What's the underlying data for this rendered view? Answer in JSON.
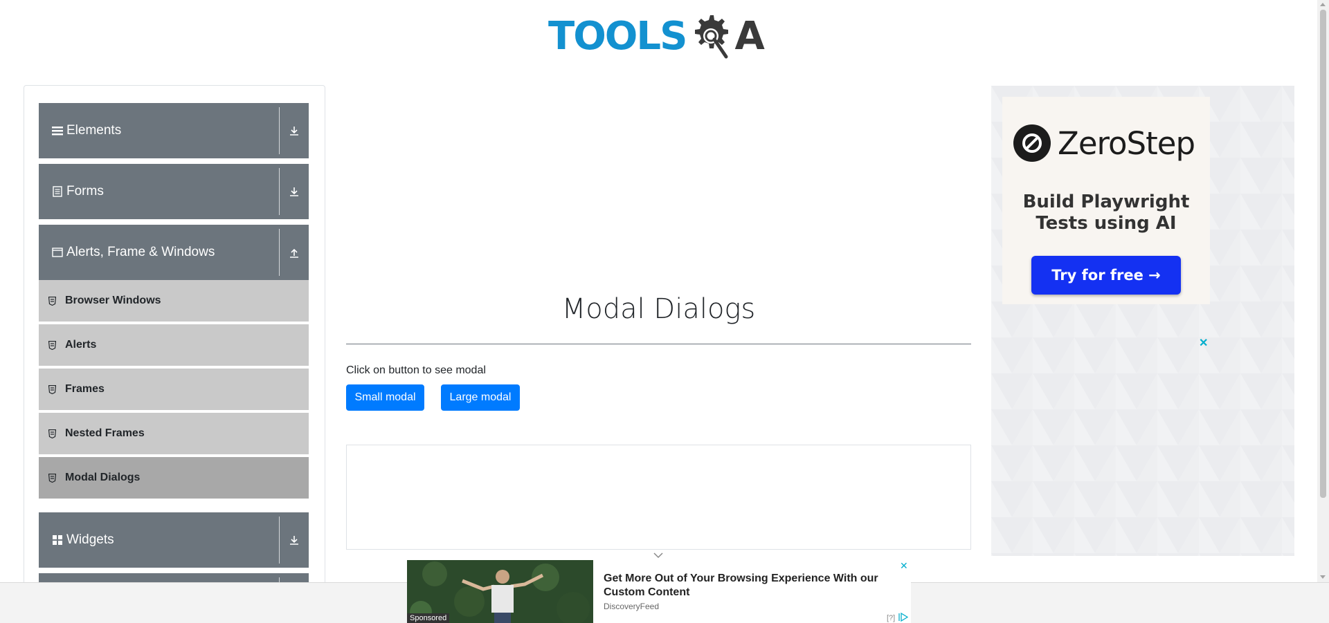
{
  "header": {
    "logo_part1": "TOOLS",
    "logo_part2": "A",
    "brand_color": "#1391d0"
  },
  "sidebar": {
    "groups": [
      {
        "label": "Elements",
        "icon": "list-icon",
        "expanded": false
      },
      {
        "label": "Forms",
        "icon": "document-icon",
        "expanded": false
      },
      {
        "label": "Alerts, Frame & Windows",
        "icon": "window-icon",
        "expanded": true
      },
      {
        "label": "Widgets",
        "icon": "grid-icon",
        "expanded": false
      }
    ],
    "items": [
      {
        "label": "Browser Windows"
      },
      {
        "label": "Alerts"
      },
      {
        "label": "Frames"
      },
      {
        "label": "Nested Frames"
      },
      {
        "label": "Modal Dialogs",
        "active": true
      }
    ]
  },
  "main": {
    "title": "Modal Dialogs",
    "instruction": "Click on button to see modal",
    "small_button": "Small modal",
    "large_button": "Large modal",
    "button_color": "#007bff"
  },
  "right_ad": {
    "brand": "ZeroStep",
    "tagline": "Build Playwright Tests using AI",
    "cta": "Try for free →",
    "close": "✕"
  },
  "bottom_ad": {
    "title": "Get More Out of Your Browsing Experience With our Custom Content",
    "source": "DiscoveryFeed",
    "sponsored": "Sponsored",
    "help": "[?]",
    "close": "✕"
  }
}
